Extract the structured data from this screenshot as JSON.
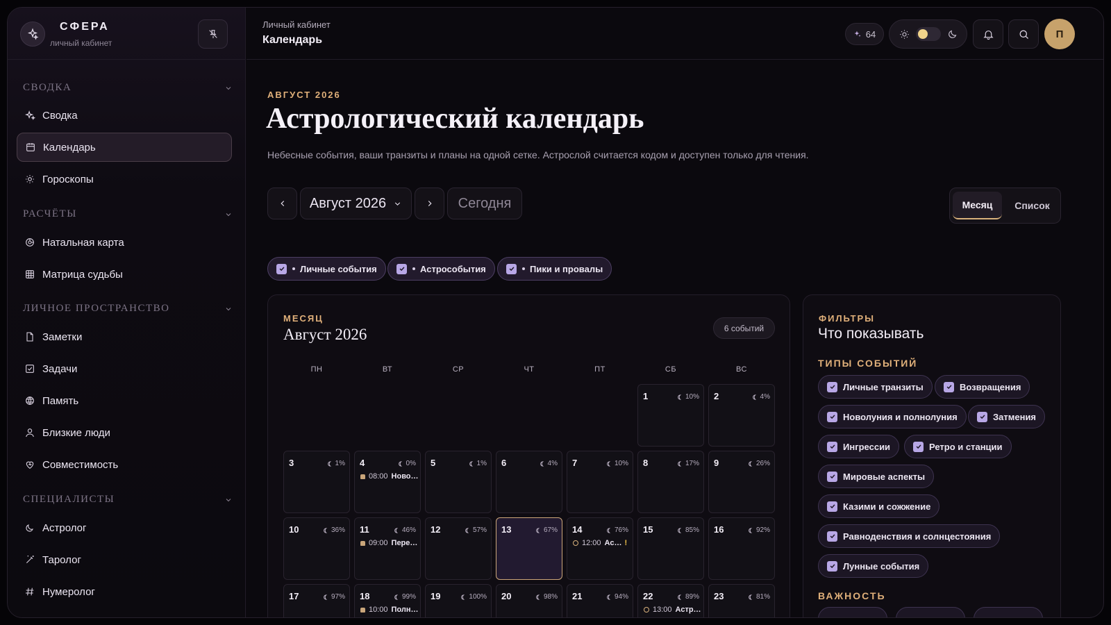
{
  "brand": {
    "name": "СФЕРА",
    "subtitle": "личный кабинет"
  },
  "sidebar": {
    "sections": [
      {
        "label": "СВОДКА"
      },
      {
        "label": "РАСЧЁТЫ"
      },
      {
        "label": "ЛИЧНОЕ ПРОСТРАНСТВО"
      },
      {
        "label": "СПЕЦИАЛИСТЫ"
      }
    ],
    "items": [
      {
        "label": "Сводка",
        "icon": "sparkle-icon"
      },
      {
        "label": "Календарь",
        "icon": "calendar-icon",
        "active": true
      },
      {
        "label": "Гороскопы",
        "icon": "sun-icon"
      },
      {
        "label": "Натальная карта",
        "icon": "chart-wheel-icon"
      },
      {
        "label": "Матрица судьбы",
        "icon": "grid-icon"
      },
      {
        "label": "Заметки",
        "icon": "note-icon"
      },
      {
        "label": "Задачи",
        "icon": "checkbox-icon"
      },
      {
        "label": "Память",
        "icon": "memory-icon"
      },
      {
        "label": "Близкие люди",
        "icon": "person-icon"
      },
      {
        "label": "Совместимость",
        "icon": "heart-icon"
      },
      {
        "label": "Астролог",
        "icon": "moon-icon"
      },
      {
        "label": "Таролог",
        "icon": "wand-icon"
      },
      {
        "label": "Нумеролог",
        "icon": "hash-icon"
      }
    ]
  },
  "header": {
    "breadcrumb": "Личный кабинет",
    "page": "Календарь",
    "coins": "64",
    "avatar_letter": "П"
  },
  "main": {
    "eyebrow": "АВГУСТ 2026",
    "title": "Астрологический календарь",
    "subtitle": "Небесные события, ваши транзиты и планы на одной сетке. Астрослой считается кодом и доступен только для чтения.",
    "month_select": "Август 2026",
    "today_button": "Сегодня",
    "view_tabs": [
      "Месяц",
      "Список"
    ],
    "chips": [
      "Личные события",
      "Астрособытия",
      "Пики и провалы"
    ]
  },
  "calendar": {
    "eyebrow": "МЕСЯЦ",
    "title": "Август 2026",
    "events_count": "6 событий",
    "weekdays": [
      "ПН",
      "ВТ",
      "СР",
      "ЧТ",
      "ПТ",
      "СБ",
      "ВС"
    ],
    "days": [
      {
        "day": "1",
        "moon": "10%",
        "col": 5,
        "row": 0
      },
      {
        "day": "2",
        "moon": "4%",
        "col": 6,
        "row": 0
      },
      {
        "day": "3",
        "moon": "1%",
        "col": 0,
        "row": 1
      },
      {
        "day": "4",
        "moon": "0%",
        "col": 1,
        "row": 1,
        "event_time": "08:00",
        "event_title": "Ново…",
        "event_kind": "personal"
      },
      {
        "day": "5",
        "moon": "1%",
        "col": 2,
        "row": 1
      },
      {
        "day": "6",
        "moon": "4%",
        "col": 3,
        "row": 1
      },
      {
        "day": "7",
        "moon": "10%",
        "col": 4,
        "row": 1
      },
      {
        "day": "8",
        "moon": "17%",
        "col": 5,
        "row": 1
      },
      {
        "day": "9",
        "moon": "26%",
        "col": 6,
        "row": 1
      },
      {
        "day": "10",
        "moon": "36%",
        "col": 0,
        "row": 2
      },
      {
        "day": "11",
        "moon": "46%",
        "col": 1,
        "row": 2,
        "event_time": "09:00",
        "event_title": "Пере…",
        "event_kind": "personal"
      },
      {
        "day": "12",
        "moon": "57%",
        "col": 2,
        "row": 2
      },
      {
        "day": "13",
        "moon": "67%",
        "col": 3,
        "row": 2,
        "today": true
      },
      {
        "day": "14",
        "moon": "76%",
        "col": 4,
        "row": 2,
        "event_time": "12:00",
        "event_title": "Ас…",
        "event_kind": "astro",
        "flag": "!"
      },
      {
        "day": "15",
        "moon": "85%",
        "col": 5,
        "row": 2
      },
      {
        "day": "16",
        "moon": "92%",
        "col": 6,
        "row": 2
      },
      {
        "day": "17",
        "moon": "97%",
        "col": 0,
        "row": 3
      },
      {
        "day": "18",
        "moon": "99%",
        "col": 1,
        "row": 3,
        "event_time": "10:00",
        "event_title": "Полн…",
        "event_kind": "personal"
      },
      {
        "day": "19",
        "moon": "100%",
        "col": 2,
        "row": 3
      },
      {
        "day": "20",
        "moon": "98%",
        "col": 3,
        "row": 3
      },
      {
        "day": "21",
        "moon": "94%",
        "col": 4,
        "row": 3
      },
      {
        "day": "22",
        "moon": "89%",
        "col": 5,
        "row": 3,
        "event_time": "13:00",
        "event_title": "Астр…",
        "event_kind": "astro"
      },
      {
        "day": "23",
        "moon": "81%",
        "col": 6,
        "row": 3
      }
    ]
  },
  "filters": {
    "eyebrow": "ФИЛЬТРЫ",
    "title": "Что показывать",
    "types_label": "ТИПЫ СОБЫТИЙ",
    "types": [
      "Личные транзиты",
      "Возвращения",
      "Новолуния и полнолуния",
      "Затмения",
      "Ингрессии",
      "Ретро и станции",
      "Мировые аспекты",
      "Казими и сожжение",
      "Равноденствия и солнцестояния",
      "Лунные события"
    ],
    "importance_label": "ВАЖНОСТЬ"
  },
  "colors": {
    "accent": "#e0b07a",
    "checkbox": "#b8a7e6",
    "background": "#0b090e"
  }
}
